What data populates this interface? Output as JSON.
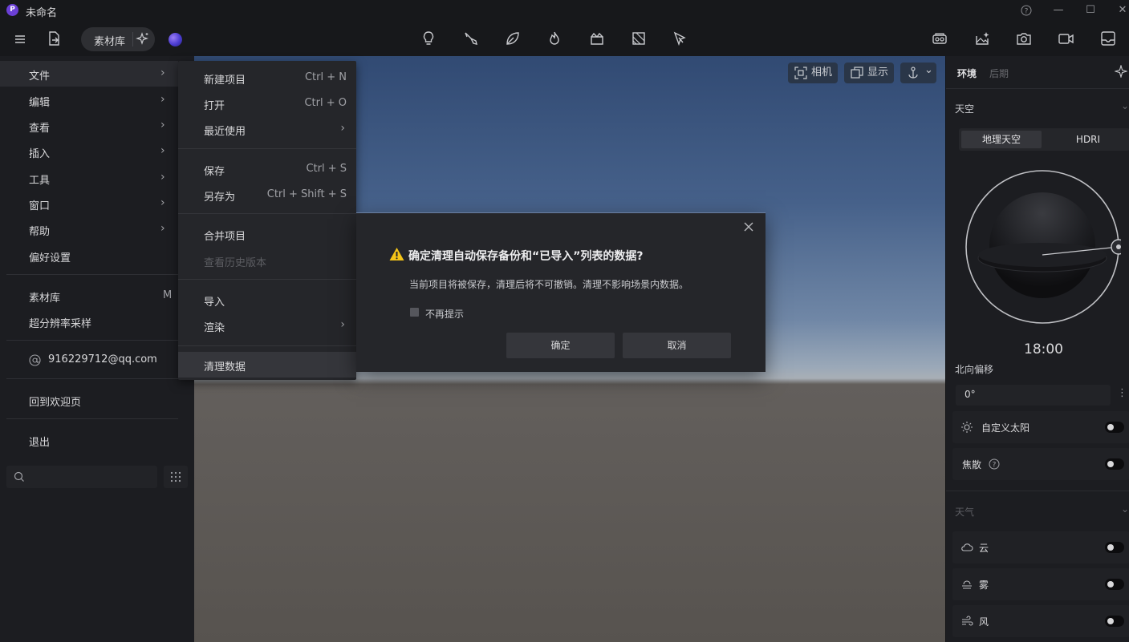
{
  "window": {
    "title": "未命名",
    "logo_letter": "P",
    "help_glyph": "?",
    "minimize_glyph": "—",
    "maximize_glyph": "☐",
    "close_glyph": "✕"
  },
  "toolbar": {
    "library_label": "素材库",
    "icons_center": [
      "lightbulb-icon",
      "pen-tool-icon",
      "leaf-icon",
      "fire-icon",
      "clapper-icon",
      "texture-icon",
      "flag-pointer-icon"
    ],
    "icons_right": [
      "vr-headset-icon",
      "image-sparkle-icon",
      "camera-icon",
      "video-camera-icon",
      "gallery-icon"
    ]
  },
  "viewport": {
    "camera_label": "相机",
    "display_label": "显示",
    "chevron": "⌄"
  },
  "main_menu": {
    "items": [
      {
        "label": "文件",
        "chevron": "›"
      },
      {
        "label": "编辑",
        "chevron": "›"
      },
      {
        "label": "查看",
        "chevron": "›"
      },
      {
        "label": "插入",
        "chevron": "›"
      },
      {
        "label": "工具",
        "chevron": "›"
      },
      {
        "label": "窗口",
        "chevron": "›"
      },
      {
        "label": "帮助",
        "chevron": "›"
      },
      {
        "label": "偏好设置"
      }
    ],
    "library": {
      "label": "素材库",
      "shortcut": "M"
    },
    "super_resolution": "超分辨率采样",
    "account_email": "916229712@qq.com",
    "back_to_welcome": "回到欢迎页",
    "exit": "退出"
  },
  "file_submenu": {
    "new_project": {
      "label": "新建项目",
      "shortcut": "Ctrl + N"
    },
    "open": {
      "label": "打开",
      "shortcut": "Ctrl + O"
    },
    "recent": {
      "label": "最近使用",
      "chevron": "›"
    },
    "save": {
      "label": "保存",
      "shortcut": "Ctrl + S"
    },
    "save_as": {
      "label": "另存为",
      "shortcut": "Ctrl + Shift + S"
    },
    "merge": {
      "label": "合并项目"
    },
    "history": {
      "label": "查看历史版本"
    },
    "import": {
      "label": "导入"
    },
    "render": {
      "label": "渲染",
      "chevron": "›"
    },
    "clean_data": {
      "label": "清理数据"
    }
  },
  "dialog": {
    "title": "确定清理自动保存备份和“已导入”列表的数据?",
    "message": "当前项目将被保存，清理后将不可撤销。清理不影响场景内数据。",
    "checkbox_label": "不再提示",
    "confirm_label": "确定",
    "cancel_label": "取消",
    "close_glyph": "✕"
  },
  "right_panel": {
    "tabs": [
      "环境",
      "后期"
    ],
    "sky_title": "天空",
    "sky_modes": [
      "地理天空",
      "HDRI"
    ],
    "selected_sky_mode": "地理天空",
    "sun_time": "18:00",
    "north_offset_label": "北向偏移",
    "north_offset_value": "0°",
    "more_glyph": "⋮",
    "custom_sun_label": "自定义太阳",
    "caustics_label": "焦散",
    "weather_title": "天气",
    "cloud_label": "云",
    "fog_label": "雾",
    "wind_label": "风",
    "section_chevron": "⌄",
    "toggles": {
      "custom_sun": false,
      "caustics": false,
      "cloud": false,
      "fog": false,
      "wind": false
    }
  },
  "colors": {
    "background": "#17181b",
    "panel": "#1c1d21",
    "menu": "#25262a",
    "warning": "#f5c518",
    "accent_orb": "#4a3bd0"
  }
}
